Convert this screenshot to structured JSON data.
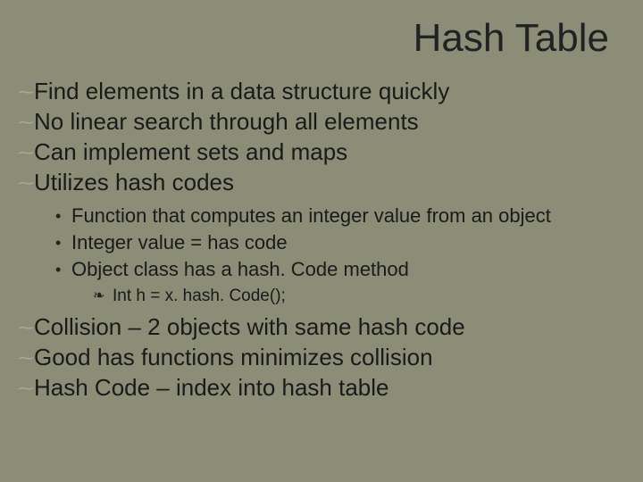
{
  "title": "Hash Table",
  "marks": {
    "l1": "⁓",
    "l2": "•",
    "l3": "❧"
  },
  "l1a": [
    "Find elements in a data structure quickly",
    "No linear search through all elements",
    "Can implement sets and maps",
    "Utilizes hash codes"
  ],
  "l2a": [
    "Function that computes an integer value from an object",
    "Integer value = has code",
    "Object class has a hash. Code method"
  ],
  "l3a": [
    "Int h = x. hash. Code();"
  ],
  "l1b": [
    "Collision – 2 objects with same hash code",
    "Good has functions minimizes collision",
    "Hash Code – index into hash table"
  ]
}
